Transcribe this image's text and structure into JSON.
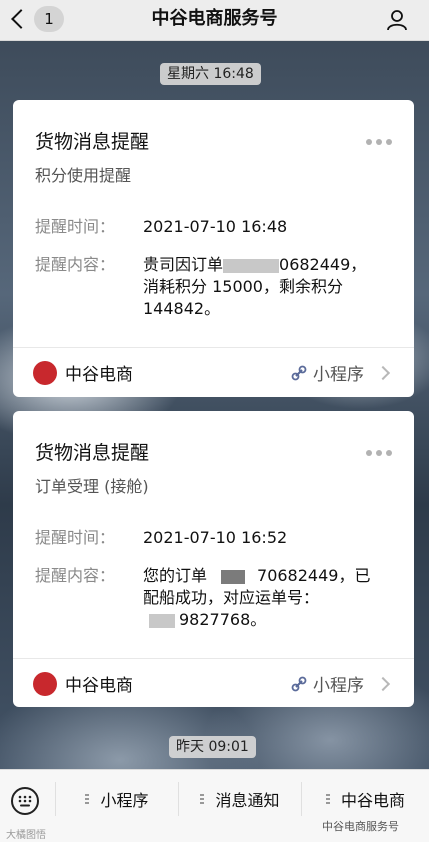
{
  "header": {
    "back_count": "1",
    "title": "中谷电商服务号"
  },
  "timestamps": {
    "first": "星期六 16:48",
    "second": "昨天 09:01"
  },
  "cards": [
    {
      "title": "货物消息提醒",
      "subtitle": "积分使用提醒",
      "time_label": "提醒时间：",
      "time_value": "2021-07-10 16:48",
      "content_label": "提醒内容：",
      "content_line1_a": "贵司因订单",
      "content_line1_b": "0682449，",
      "content_line2": "消耗积分 15000，剩余积分",
      "content_line3": "144842。",
      "brand": "中谷电商",
      "mini_program": "小程序"
    },
    {
      "title": "货物消息提醒",
      "subtitle": "订单受理 (接舱)",
      "time_label": "提醒时间：",
      "time_value": "2021-07-10 16:52",
      "content_label": "提醒内容：",
      "content_line1_a": "您的订单",
      "content_line1_b": "70682449，已",
      "content_line2": "配船成功，对应运单号：",
      "content_line3": "9827768。",
      "brand": "中谷电商",
      "mini_program": "小程序"
    }
  ],
  "menu": {
    "item1": "小程序",
    "item2": "消息通知",
    "item3": "中谷电商"
  },
  "watermarks": {
    "left": "大橘图悟",
    "right": "中谷电商服务号"
  },
  "colors": {
    "brand_red": "#c8282d",
    "card_bg": "#ffffff",
    "topbar_bg": "#ededed"
  }
}
